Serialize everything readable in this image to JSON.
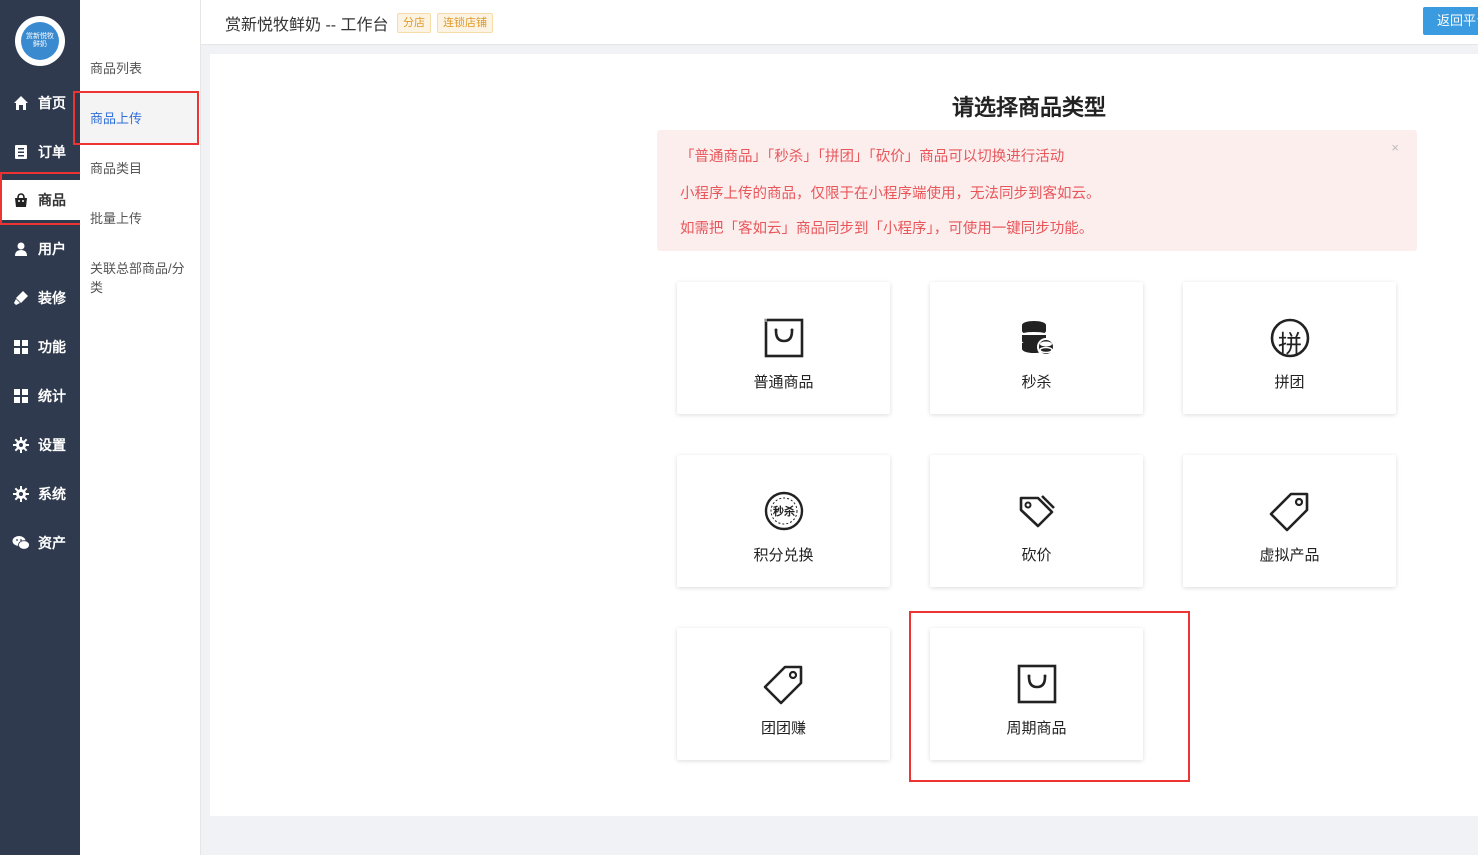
{
  "logo": {
    "text": "赏新悦牧\n鲜奶"
  },
  "nav": {
    "items": [
      {
        "label": "首页",
        "icon": "home-icon"
      },
      {
        "label": "订单",
        "icon": "order-icon"
      },
      {
        "label": "商品",
        "icon": "bag-icon"
      },
      {
        "label": "用户",
        "icon": "user-icon"
      },
      {
        "label": "装修",
        "icon": "brush-icon"
      },
      {
        "label": "功能",
        "icon": "grid-icon"
      },
      {
        "label": "统计",
        "icon": "grid-icon"
      },
      {
        "label": "设置",
        "icon": "gear-icon"
      },
      {
        "label": "系统",
        "icon": "gear-icon"
      },
      {
        "label": "资产",
        "icon": "wechat-icon"
      }
    ],
    "active_index": 2
  },
  "subnav": {
    "items": [
      {
        "label": "商品列表"
      },
      {
        "label": "商品上传"
      },
      {
        "label": "商品类目"
      },
      {
        "label": "批量上传"
      },
      {
        "label": "关联总部商品/分类"
      }
    ],
    "active_index": 1
  },
  "header": {
    "title": "赏新悦牧鲜奶 -- 工作台",
    "tag_branch": "分店",
    "tag_chain": "连锁店铺",
    "return_label": "返回平台"
  },
  "main": {
    "title": "请选择商品类型",
    "alert": {
      "line1": "「普通商品」「秒杀」「拼团」「砍价」商品可以切换进行活动",
      "line2": "小程序上传的商品，仅限于在小程序端使用，无法同步到客如云。",
      "line3": "如需把「客如云」商品同步到「小程序」，可使用一键同步功能。",
      "close": "×"
    },
    "cards": [
      {
        "label": "普通商品",
        "icon": "shopping-bag-icon"
      },
      {
        "label": "秒杀",
        "icon": "coin-stack-icon"
      },
      {
        "label": "拼团",
        "icon": "pin-circle-icon"
      },
      {
        "label": "积分兑换",
        "icon": "seckill-badge-icon"
      },
      {
        "label": "砍价",
        "icon": "bargain-tag-icon"
      },
      {
        "label": "虚拟产品",
        "icon": "price-tag-icon"
      },
      {
        "label": "团团赚",
        "icon": "price-tag-icon"
      },
      {
        "label": "周期商品",
        "icon": "shopping-bag-icon"
      }
    ],
    "seckill_badge_text": "秒杀",
    "pin_char": "拼"
  }
}
